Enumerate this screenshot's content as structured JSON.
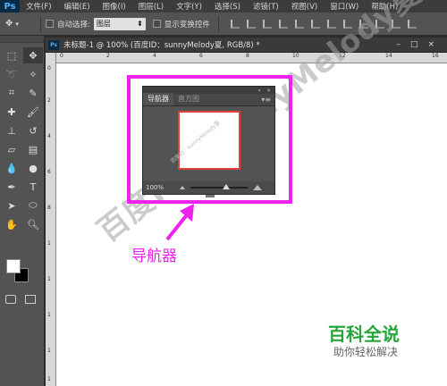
{
  "app": {
    "logo": "Ps",
    "menu": [
      "文件(F)",
      "编辑(E)",
      "图像(I)",
      "图层(L)",
      "文字(Y)",
      "选择(S)",
      "滤镜(T)",
      "视图(V)",
      "窗口(W)",
      "帮助(H)"
    ]
  },
  "options": {
    "auto_select_label": "自动选择:",
    "auto_select_value": "图层",
    "show_transform_label": "显示变换控件"
  },
  "document": {
    "tab_logo": "Ps",
    "tab_title": "未标题-1 @ 100% (百度ID：sunnyMelody夏, RGB/8) *",
    "controls": [
      "–",
      "□",
      "×"
    ],
    "ruler_top_ticks": [
      "0",
      "2",
      "4",
      "6",
      "8",
      "10",
      "12",
      "14",
      "16"
    ],
    "ruler_left_ticks": [
      "0",
      "2",
      "4",
      "6",
      "8",
      "1",
      "1",
      "1",
      "1",
      "1"
    ]
  },
  "navigator": {
    "tab_active": "导航器",
    "tab_inactive": "直方图",
    "collapse_icon": "«",
    "close_icon": "×",
    "menu_icon": "▾≡",
    "zoom": "100%",
    "zoom_fraction": 0.62,
    "thumb_watermark": "百度ID：sunnyMelody夏"
  },
  "annotation": {
    "label": "导航器",
    "highlight_color": "#ee22ee"
  },
  "watermark": "百度ID：sunnyMelody夏",
  "brand": {
    "title": "百科全说",
    "subtitle": "助你轻松解决",
    "color": "#27a53a"
  },
  "icons": [
    "move-icon",
    "marquee-icon",
    "lasso-icon",
    "magic-wand-icon",
    "crop-icon",
    "eyedropper-icon",
    "healing-brush-icon",
    "brush-icon",
    "clone-stamp-icon",
    "history-brush-icon",
    "eraser-icon",
    "gradient-icon",
    "blur-icon",
    "dodge-icon",
    "pen-icon",
    "type-icon",
    "path-select-icon",
    "shape-icon",
    "hand-icon",
    "zoom-icon"
  ]
}
